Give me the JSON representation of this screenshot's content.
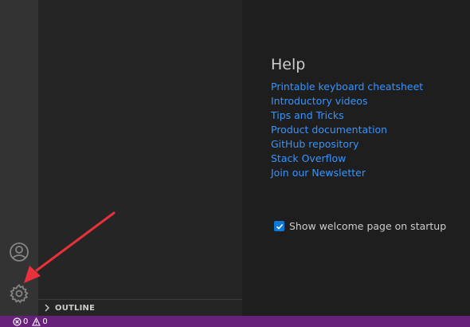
{
  "activity_bar": {
    "account_icon": "account-icon",
    "settings_icon": "gear-icon"
  },
  "sidebar": {
    "outline_label": "OUTLINE"
  },
  "help": {
    "title": "Help",
    "links": [
      "Printable keyboard cheatsheet",
      "Introductory videos",
      "Tips and Tricks",
      "Product documentation",
      "GitHub repository",
      "Stack Overflow",
      "Join our Newsletter"
    ]
  },
  "startup": {
    "checked": true,
    "label": "Show welcome page on startup"
  },
  "status_bar": {
    "errors": "0",
    "warnings": "0",
    "background": "#68217a"
  },
  "colors": {
    "link": "#3794ff",
    "annotation_arrow": "#e8313a"
  }
}
